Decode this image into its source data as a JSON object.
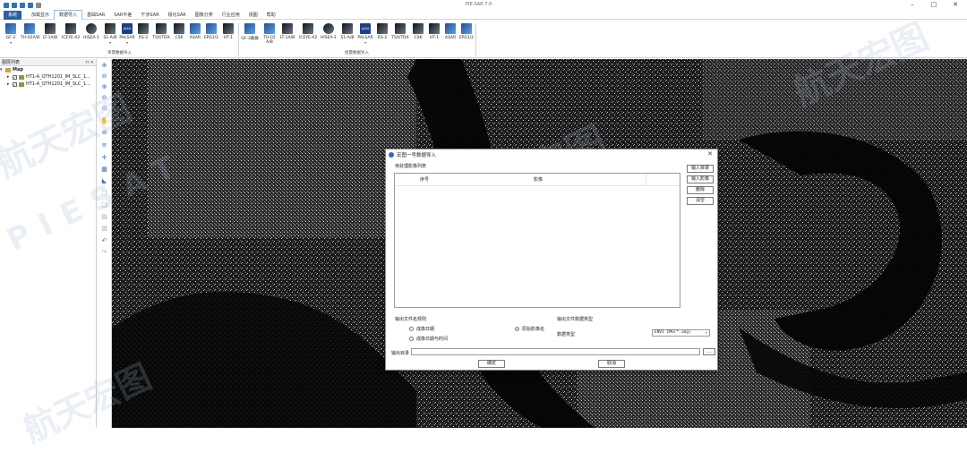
{
  "app": {
    "title": "PIE-SAR 7.0"
  },
  "menu": {
    "tabs": [
      "系统",
      "加载显示",
      "数据导入",
      "基础SAR",
      "SAR平差",
      "干涉SAR",
      "极化SAR",
      "图像分类",
      "行业应用",
      "视图",
      "帮助"
    ],
    "active_index": 2
  },
  "ribbon": {
    "single_buttons": [
      "GF-3",
      "TH-02A/B",
      "LT-1A/B",
      "ICEYE-X2",
      "HISEA-1",
      "S1-A/B",
      "PALSAR",
      "RS-2",
      "TSX/TDX",
      "CSK",
      "ASAR",
      "ERS1/2",
      "HT-1"
    ],
    "single_group_label": "单景数据导入",
    "batch_buttons": [
      "GF-3集群",
      "TH-02 A/B",
      "LT-1A/B",
      "ICEYE-X2",
      "HISEA-1",
      "S1-A/B",
      "PALSAR",
      "RS-2",
      "TSX/TDX",
      "CSK",
      "HT-1",
      "ASAR",
      "ERS1/2"
    ],
    "batch_group_label": "批量数据导入",
    "jaxa_text": "JAXA"
  },
  "layers": {
    "title": "图层列表",
    "root": "Map",
    "items": [
      "HT1-A_QTH1201_IM_SLC_1...",
      "HT1-A_QTH1201_IM_SLC_1..."
    ]
  },
  "dialog": {
    "title": "宏图一号数据导入",
    "list_label": "待处理影像列表",
    "col_index": "序号",
    "col_image": "影像",
    "btn_input_dir": "输入目录",
    "btn_input_image": "输入影像",
    "btn_delete": "删除",
    "btn_clear": "清空",
    "output_name_rule": "输出文件名规则",
    "opt_date": "成像日期",
    "opt_original": "原始影像名",
    "opt_datetime": "成像日期与时间",
    "output_type_label": "输出文件数据类型",
    "data_type_label": "数据类型",
    "data_type_value": "ENVI IMG(*.img)",
    "output_dir_label": "输出目录",
    "browse": "...",
    "ok": "确定",
    "cancel": "取消"
  },
  "watermark": {
    "text1": "航天宏图",
    "text2": "PIESAT"
  }
}
